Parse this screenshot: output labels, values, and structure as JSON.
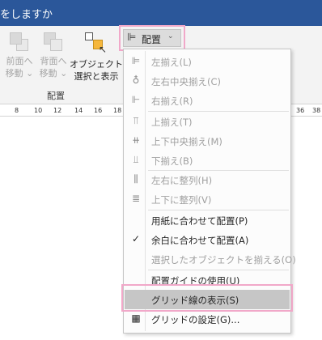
{
  "window": {
    "title": "をしますか"
  },
  "ribbon": {
    "bring_forward": {
      "line1": "前面へ",
      "line2": "移動",
      "chevron": "⌄"
    },
    "send_backward": {
      "line1": "背面へ",
      "line2": "移動",
      "chevron": "⌄"
    },
    "selection_pane": {
      "line1": "オブジェクトの",
      "line2": "選択と表示"
    },
    "arrange_group_label": "配置",
    "align_button": {
      "label": "配置",
      "chevron": "⌄"
    }
  },
  "ruler": {
    "left_ticks": [
      "8",
      "10",
      "12",
      "14",
      "16",
      "18"
    ],
    "right_ticks": [
      "36",
      "38"
    ]
  },
  "menu": {
    "items": [
      {
        "label": "左揃え(L)",
        "icon": "align-left-icon",
        "glyph": "⊫",
        "enabled": false
      },
      {
        "label": "左右中央揃え(C)",
        "icon": "align-center-icon",
        "glyph": "♁",
        "enabled": false
      },
      {
        "label": "右揃え(R)",
        "icon": "align-right-icon",
        "glyph": "⊩",
        "enabled": false
      },
      {
        "label": "上揃え(T)",
        "icon": "align-top-icon",
        "glyph": "⫪",
        "enabled": false
      },
      {
        "label": "上下中央揃え(M)",
        "icon": "align-middle-icon",
        "glyph": "⧺",
        "enabled": false
      },
      {
        "label": "下揃え(B)",
        "icon": "align-bottom-icon",
        "glyph": "⫫",
        "enabled": false
      },
      {
        "label": "左右に整列(H)",
        "icon": "distribute-horizontal-icon",
        "glyph": "⫼",
        "enabled": false
      },
      {
        "label": "上下に整列(V)",
        "icon": "distribute-vertical-icon",
        "glyph": "≣",
        "enabled": false
      },
      {
        "label": "用紙に合わせて配置(P)",
        "icon": "",
        "glyph": "",
        "enabled": true
      },
      {
        "label": "余白に合わせて配置(A)",
        "icon": "checkmark-icon",
        "glyph": "✓",
        "enabled": true
      },
      {
        "label": "選択したオブジェクトを揃える(O)",
        "icon": "",
        "glyph": "",
        "enabled": false
      },
      {
        "label": "配置ガイドの使用(U)",
        "icon": "",
        "glyph": "",
        "enabled": true
      },
      {
        "label": "グリッド線の表示(S)",
        "icon": "",
        "glyph": "",
        "enabled": true,
        "selected": true
      },
      {
        "label": "グリッドの設定(G)...",
        "icon": "grid-icon",
        "glyph": "▦",
        "enabled": true
      }
    ]
  },
  "colors": {
    "title_bar": "#2b579a",
    "highlight_box": "#f1a8c9",
    "selected_item": "#c6c6c6"
  }
}
